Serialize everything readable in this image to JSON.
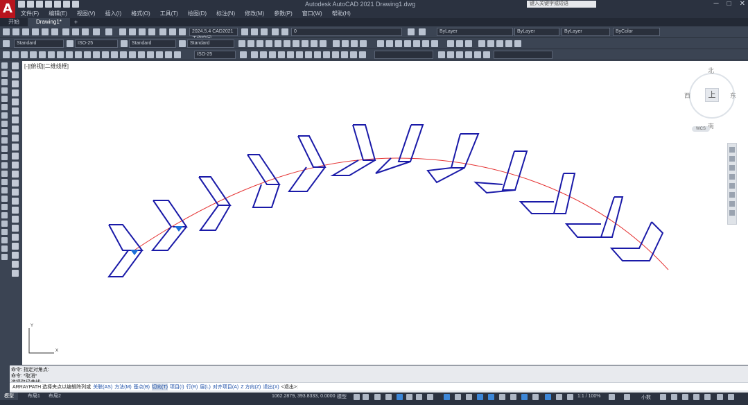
{
  "app": {
    "logo": "A",
    "document_title": "Autodesk AutoCAD 2021   Drawing1.dwg",
    "search_placeholder": "键入关键字或短语"
  },
  "menu": [
    "文件(F)",
    "编辑(E)",
    "视图(V)",
    "插入(I)",
    "格式(O)",
    "工具(T)",
    "绘图(D)",
    "标注(N)",
    "修改(M)",
    "参数(P)",
    "窗口(W)",
    "帮助(H)"
  ],
  "tabs": [
    "开始",
    "Drawing1*"
  ],
  "toolbar": {
    "workspace": "2024.5.4 CAD2021 工作空间",
    "layer": "0",
    "color": "ByLayer",
    "linetype": "ByLayer",
    "lineweight": "ByLayer",
    "plotstyle": "ByColor",
    "text_style": "Standard",
    "dim_style": "ISO-25",
    "table_style": "Standard",
    "mleader_style": "Standard",
    "dim_style2": "ISO-25"
  },
  "viewport": {
    "label": "[-][俯视][二维线框]",
    "cube": {
      "north": "北",
      "south": "南",
      "east": "东",
      "west": "西",
      "face": "上",
      "wcs": "WCS"
    }
  },
  "command": {
    "history": [
      "命令:  指定对角点:",
      "命令:  *取消*",
      "选择路径曲线:"
    ],
    "prompt_label": "ARRAYPATH 选择夹点以编辑阵列或",
    "options": [
      "关联(AS)",
      "方法(M)",
      "基点(B)",
      "切向(T)",
      "项目(I)",
      "行(R)",
      "层(L)",
      "对齐项目(A)",
      "Z 方向(Z)",
      "退出(X)"
    ],
    "highlighted_option": "切向(T)",
    "suffix": "<退出>:"
  },
  "status": {
    "tabs": [
      "模型",
      "布局1",
      "布局2"
    ],
    "coords": "1062.2879, 393.8333, 0.0000",
    "model_label": "模型",
    "zoom": "1:1 / 100%",
    "units": "小数"
  }
}
